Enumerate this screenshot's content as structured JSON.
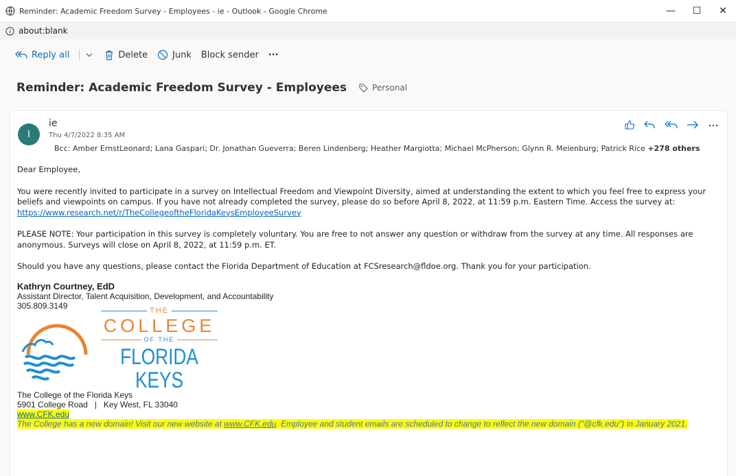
{
  "window": {
    "title": "Reminder: Academic Freedom Survey - Employees - ie - Outlook - Google Chrome",
    "minimize": "—",
    "maximize": "☐",
    "close": "✕"
  },
  "address": {
    "url": "about:blank"
  },
  "toolbar": {
    "reply_all": "Reply all",
    "delete": "Delete",
    "junk": "Junk",
    "block_sender": "Block sender",
    "more": "···"
  },
  "message": {
    "subject": "Reminder: Academic Freedom Survey - Employees",
    "tag": "Personal",
    "avatar_initial": "I",
    "sender": "ie",
    "date": "Thu 4/7/2022 8:35 AM",
    "bcc_label": "Bcc:",
    "bcc_recipients": "Amber ErnstLeonard;  Lana Gaspari;  Dr. Jonathan Gueverra;  Beren Lindenberg;  Heather Margiotta;  Michael McPherson;  Glynn R. Meienburg;  Patrick Rice",
    "bcc_more": "+278 others"
  },
  "body": {
    "greeting": "Dear Employee,",
    "p1": "You were recently invited to participate in a survey on Intellectual Freedom and Viewpoint Diversity, aimed at understanding the extent to which you feel free to express your beliefs and viewpoints on campus. If you have not already completed the survey, please do so before April 8, 2022, at 11:59 p.m. Eastern Time. Access the survey at: ",
    "survey_link": "https://www.research.net/r/TheCollegeoftheFloridaKeysEmployeeSurvey",
    "p2": "PLEASE NOTE: Your participation in this survey is completely voluntary. You are free to not answer any question or withdraw from the survey at any time. All responses are anonymous. Surveys will close on April 8, 2022, at 11:59 p.m. ET.",
    "p3": "Should you have any questions, please contact the Florida Department of Education at FCSresearch@fldoe.org. Thank you for your participation."
  },
  "signature": {
    "name": "Kathryn Courtney, EdD",
    "title": "Assistant Director, Talent Acquisition, Development, and Accountability",
    "phone": "305.809.3149",
    "logo": {
      "the": "THE",
      "college": "COLLEGE",
      "of_the": "OF THE",
      "florida_keys": "FLORIDA KEYS"
    },
    "org": "The College of the Florida Keys",
    "street": "5901 College Road   |   Key West, FL 33040",
    "website": "www.CFK.edu",
    "notice_a": "The College has a new domain! Visit our new website at ",
    "notice_link": "www.CFK.edu",
    "notice_b": ". Employee and student emails are scheduled to change to reflect the new domain (\"@cfk.edu\") in January 2021."
  },
  "colors": {
    "orange": "#e8852f",
    "blue": "#1e8fd0",
    "teal_avatar": "#2b7a77",
    "accent": "#0f6cbd",
    "highlight": "#ffff00"
  }
}
